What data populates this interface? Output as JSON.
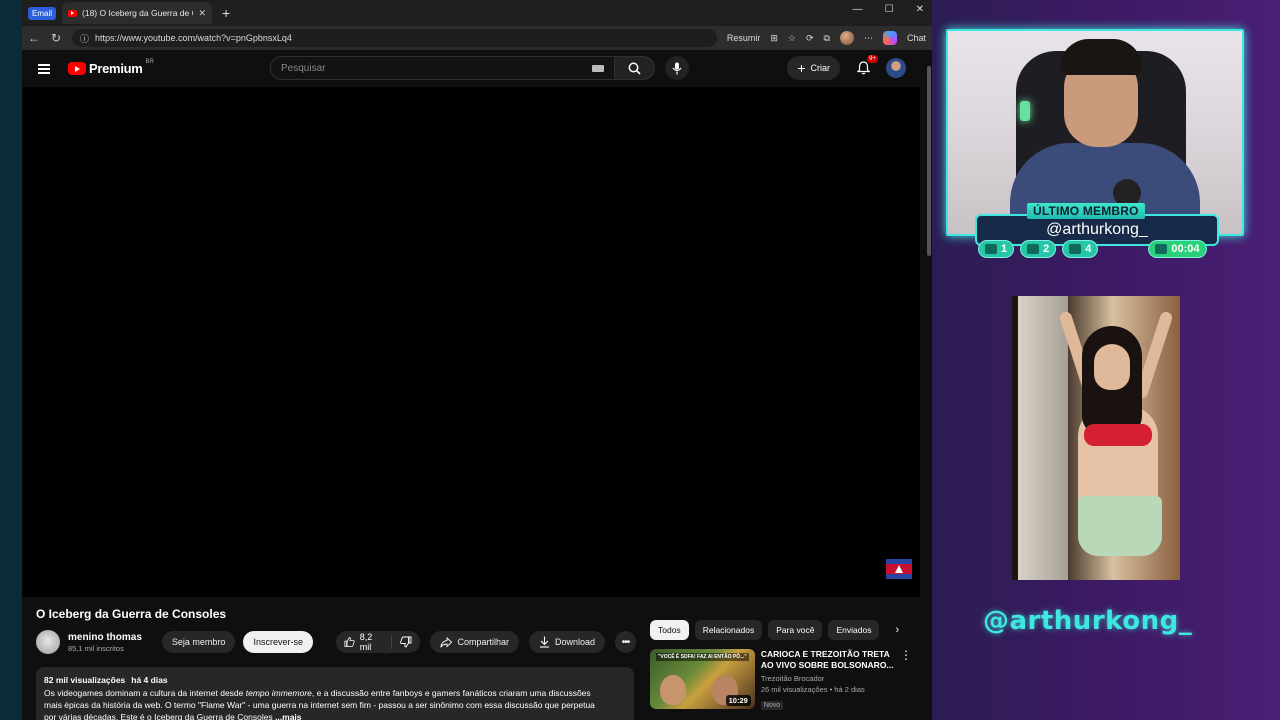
{
  "browser": {
    "email_chip": "Email",
    "tab_title": "(18) O Iceberg da Guerra de Consoles",
    "url": "https://www.youtube.com/watch?v=pnGpbnsxLq4",
    "summarize_label": "Resumir",
    "chat_label": "Chat"
  },
  "youtube": {
    "brand": "Premium",
    "region": "BR",
    "search_placeholder": "Pesquisar",
    "create_label": "Criar",
    "notifications_badge": "9+",
    "video_title": "O Iceberg da Guerra de Consoles",
    "channel": {
      "name": "menino thomas",
      "subscribers": "85,1 mil inscritos",
      "join_label": "Seja membro",
      "subscribe_label": "Inscrever-se"
    },
    "actions": {
      "likes": "8,2 mil",
      "share_label": "Compartilhar",
      "download_label": "Download"
    },
    "description": {
      "views": "82 mil visualizações",
      "date": "há 4 dias",
      "line1_a": "Os videogames dominam a cultura da internet desde ",
      "line1_italic": "tempo immemore",
      "line1_b": ", e a discussão entre fanboys e gamers fanáticos criaram uma discussões",
      "line2": "mais épicas da história da web. O termo \"Flame War\" - uma guerra na internet sem fim - passou a ser sinônimo com essa discussão que perpetua",
      "line3": "por várias décadas. Este é o Iceberg da Guerra de Consoles",
      "more": "...mais"
    },
    "chips": [
      "Todos",
      "Relacionados",
      "Para você",
      "Enviados"
    ],
    "recommendation": {
      "thumb_text": "\"VOCÊ É SDFA! FAZ AI ENTÃO PÔ...\"",
      "duration": "10:29",
      "title": "CARIOCA E TREZOITÃO TRETA AO VIVO SOBRE BOLSONARO...",
      "channel": "Trezoitão Brocador",
      "stats": "26 mil visualizações • há 2 dias",
      "badge": "Novo"
    }
  },
  "overlay": {
    "member_title": "ÚLTIMO MEMBRO",
    "member_name": "@arthurkong_",
    "stats": [
      "1",
      "2",
      "4"
    ],
    "timer": "00:04",
    "handle": "@arthurkong_",
    "accent": "#3ee8e0"
  }
}
